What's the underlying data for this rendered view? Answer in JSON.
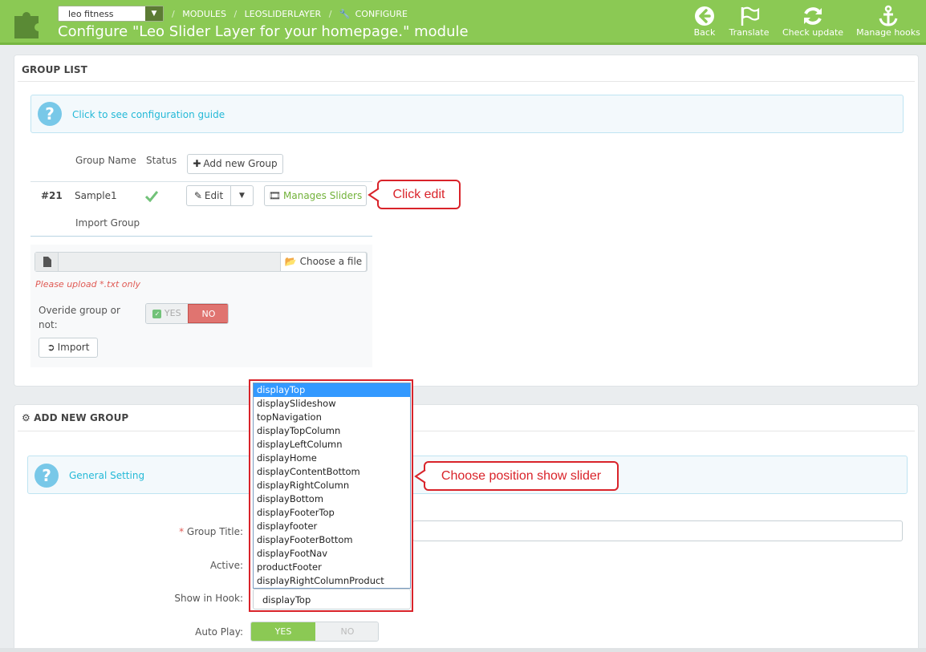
{
  "header": {
    "shop_selector": "leo fitness",
    "breadcrumb": [
      "MODULES",
      "LEOSLIDERLAYER",
      "CONFIGURE"
    ],
    "title": "Configure \"Leo Slider Layer for your homepage.\" module",
    "toolbar": {
      "back": "Back",
      "translate": "Translate",
      "check_update": "Check update",
      "manage_hooks": "Manage hooks"
    },
    "colors": {
      "bar": "#8bc954",
      "accent_dark": "#5c7b34"
    }
  },
  "group_list": {
    "heading": "GROUP LIST",
    "guide_link": "Click to see configuration guide",
    "columns": {
      "name": "Group Name",
      "status": "Status"
    },
    "add_button": "Add new Group",
    "row": {
      "id": "#21",
      "name": "Sample1",
      "edit": "Edit",
      "manage": "Manages Sliders"
    },
    "import_label": "Import Group",
    "choose_file": "Choose a file",
    "upload_hint": "Please upload *.txt only",
    "override_label_1": "Overide group or",
    "override_label_2": "not:",
    "yes": "YES",
    "no": "NO",
    "import_button": "Import"
  },
  "callouts": {
    "click_edit": "Click edit",
    "choose_position": "Choose position show slider"
  },
  "add_group": {
    "heading": "ADD NEW GROUP",
    "general_setting": "General Setting",
    "group_title_label": "Group Title:",
    "group_title_value": "",
    "active_label": "Active:",
    "hook_label": "Show in Hook:",
    "hook_selected": "displayTop",
    "hook_options": [
      "displayTop",
      "displaySlideshow",
      "topNavigation",
      "displayTopColumn",
      "displayLeftColumn",
      "displayHome",
      "displayContentBottom",
      "displayRightColumn",
      "displayBottom",
      "displayFooterTop",
      "displayfooter",
      "displayFooterBottom",
      "displayFootNav",
      "productFooter",
      "displayRightColumnProduct"
    ],
    "autoplay_label": "Auto Play:",
    "autoplay_yes": "YES",
    "autoplay_no": "NO"
  }
}
